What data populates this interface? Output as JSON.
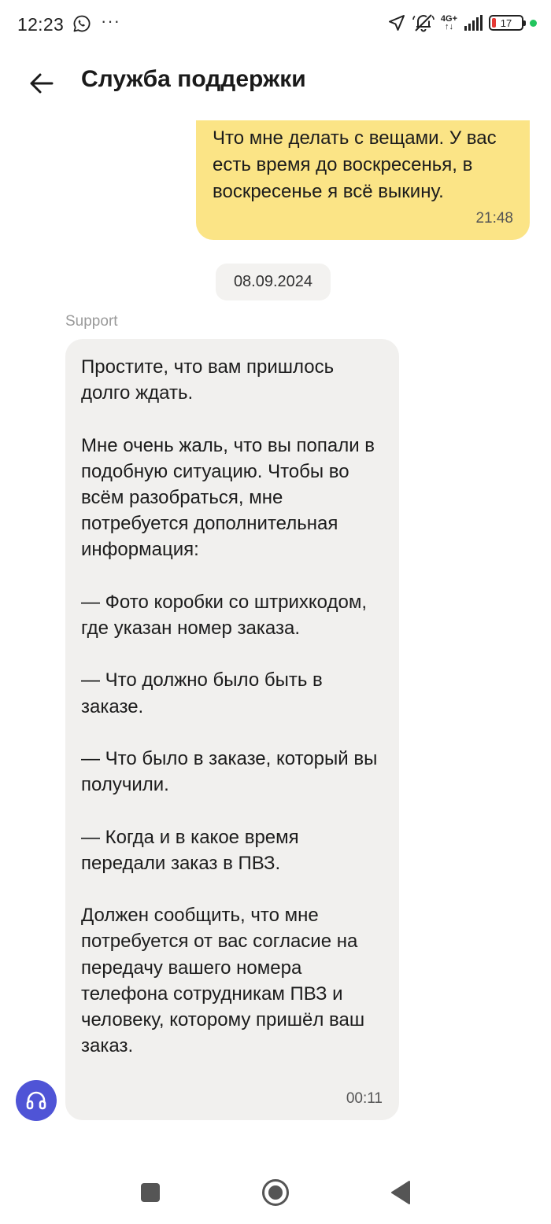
{
  "status_bar": {
    "time": "12:23",
    "left_icons": [
      "whatsapp-icon",
      "more-dots-icon"
    ],
    "more_dots": "···",
    "network_label_top": "4G+",
    "network_label_bottom": "↑↓",
    "battery_level": "17",
    "right_icons": [
      "location-arrow-icon",
      "muted-bell-icon",
      "signal-icon",
      "battery-icon",
      "green-dot"
    ]
  },
  "header": {
    "title": "Служба поддержки",
    "back_icon": "arrow-left-icon"
  },
  "messages": {
    "outgoing": {
      "text": "Что мне делать с вещами. У вас есть время до воскресенья, в воскресенье я всё выкину.",
      "time": "21:48"
    },
    "date_separator": "08.09.2024",
    "incoming": {
      "sender": "Support",
      "text": "Простите, что вам пришлось долго ждать.\n\nМне очень жаль, что вы попали в подобную ситуацию. Чтобы во всём разобраться, мне потребуется дополнительная информация:\n\n— Фото коробки со штрихкодом, где указан номер заказа.\n\n— Что должно было быть в заказе.\n\n— Что было в заказе, который вы получили.\n\n— Когда и в какое время передали заказ в ПВЗ.\n\nДолжен сообщить, что мне потребуется от вас согласие на передачу вашего номера телефона сотрудникам ПВЗ и человеку, которому пришёл ваш заказ.",
      "time": "00:11"
    }
  },
  "fab": {
    "icon": "headset-icon"
  },
  "nav_bar": {
    "buttons": [
      "recents-square-icon",
      "home-circle-icon",
      "back-triangle-icon"
    ]
  },
  "colors": {
    "outgoing_bubble": "#fbe486",
    "incoming_bubble": "#f1f0ee",
    "fab": "#4f54d6",
    "battery_low": "#e53935",
    "status_dot": "#22c55e"
  }
}
